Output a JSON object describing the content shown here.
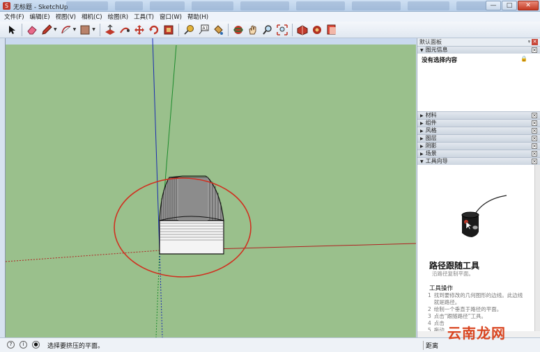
{
  "window": {
    "title": "无标题 - SketchUp",
    "minimize": "—",
    "maximize": "□",
    "close": "✕"
  },
  "menu": [
    "文件(F)",
    "编辑(E)",
    "视图(V)",
    "相机(C)",
    "绘图(R)",
    "工具(T)",
    "窗口(W)",
    "帮助(H)"
  ],
  "toolbar_icons": [
    "select-arrow-icon",
    "eraser-icon",
    "pencil-icon",
    "arc-icon",
    "rectangle-icon",
    "push-pull-icon",
    "follow-me-icon",
    "move-icon",
    "rotate-icon",
    "offset-icon",
    "tape-measure-icon",
    "text-label-icon",
    "paint-bucket-icon",
    "orbit-icon",
    "pan-icon",
    "zoom-icon",
    "zoom-extents-icon",
    "3d-warehouse-icon",
    "extension-warehouse-icon",
    "layout-icon"
  ],
  "tray": {
    "title": "默认面板",
    "pin": "ᵠ",
    "entity_info": {
      "label": "图元信息",
      "content": "没有选择内容"
    },
    "panels": [
      "材料",
      "组件",
      "风格",
      "图层",
      "阴影",
      "场景"
    ],
    "instructor": {
      "label": "工具向导",
      "heading": "路径跟随工具",
      "subheading": "沿路径复制平面。",
      "operations": "工具操作",
      "steps": [
        {
          "n": "1",
          "text": "找到要修改的几何图形的边线。此边线就是路径。"
        },
        {
          "n": "2",
          "text": "绘制一个垂直于路径的平面。"
        },
        {
          "n": "3",
          "text": "点击“跟随路径”工具。"
        },
        {
          "n": "4",
          "text": "点击"
        },
        {
          "n": "5",
          "text": "拖动"
        },
        {
          "n": "6",
          "text": ""
        }
      ]
    }
  },
  "status": {
    "message": "选择要挤压的平面。",
    "measurements_label": "距离"
  },
  "watermark": {
    "red": "云南",
    "dark": "龙网"
  },
  "colors": {
    "ground": "#9ac08c",
    "sky": "#c9d9ef",
    "highlight_circle": "#d03020"
  }
}
